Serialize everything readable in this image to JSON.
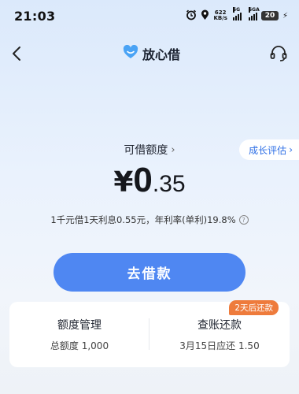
{
  "status_bar": {
    "time": "21:03",
    "net_speed_value": "622",
    "net_speed_unit": "KB/s",
    "signal1_label": "5G",
    "signal2_label": "5GA",
    "battery": "20",
    "icons": [
      "alarm-icon",
      "location-icon",
      "signal-icon",
      "battery-icon",
      "charging-icon"
    ]
  },
  "nav": {
    "title": "放心借",
    "back_icon": "chevron-left-icon",
    "service_icon": "headset-icon",
    "logo_color": "#4aa3f5"
  },
  "quota": {
    "label": "可借额度",
    "currency": "¥",
    "amount_int": "0",
    "amount_dec": ".35",
    "growth_link": "成长评估",
    "rate_text": "1千元借1天利息0.55元，年利率(单利)19.8%"
  },
  "actions": {
    "borrow_label": "去借款",
    "accent_color": "#4f87f2"
  },
  "card": {
    "left_title": "额度管理",
    "left_sub": "总额度 1,000",
    "right_title": "查账还款",
    "right_sub": "3月15日应还 1.50",
    "badge": "2天后还款",
    "badge_color": "#ee7b3c"
  }
}
